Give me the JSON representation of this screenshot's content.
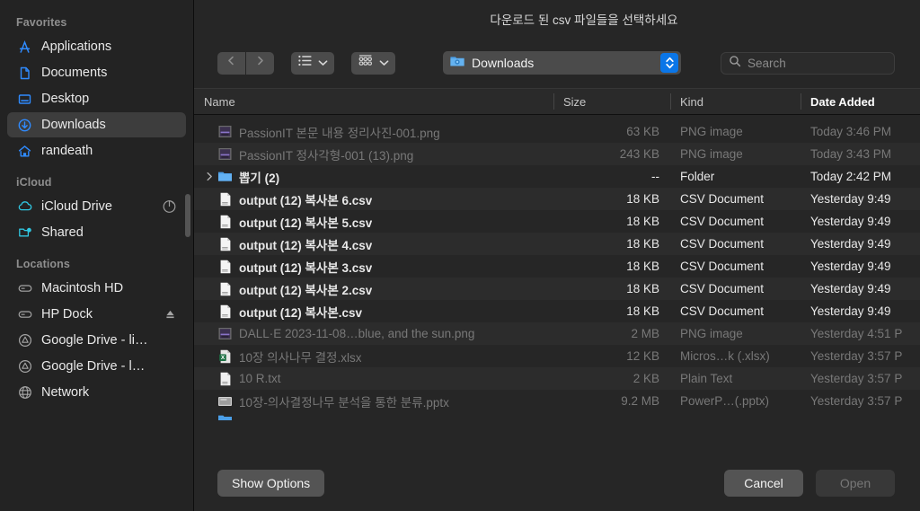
{
  "dialog": {
    "title": "다운로드 된 csv 파일들을 선택하세요"
  },
  "sidebar": {
    "groups": [
      {
        "title": "Favorites",
        "items": [
          {
            "label": "Applications",
            "icon": "applications-icon",
            "selected": false
          },
          {
            "label": "Documents",
            "icon": "document-icon",
            "selected": false
          },
          {
            "label": "Desktop",
            "icon": "desktop-icon",
            "selected": false
          },
          {
            "label": "Downloads",
            "icon": "downloads-icon",
            "selected": true
          },
          {
            "label": "randeath",
            "icon": "home-icon",
            "selected": false
          }
        ]
      },
      {
        "title": "iCloud",
        "items": [
          {
            "label": "iCloud Drive",
            "icon": "cloud-icon",
            "selected": false,
            "trailing": "progress-icon"
          },
          {
            "label": "Shared",
            "icon": "shared-folder-icon",
            "selected": false
          }
        ]
      },
      {
        "title": "Locations",
        "items": [
          {
            "label": "Macintosh HD",
            "icon": "hard-drive-icon",
            "selected": false
          },
          {
            "label": "HP Dock",
            "icon": "hard-drive-icon",
            "selected": false,
            "trailing": "eject-icon"
          },
          {
            "label": "Google Drive - li…",
            "icon": "google-drive-icon",
            "selected": false
          },
          {
            "label": "Google Drive - l…",
            "icon": "google-drive-icon",
            "selected": false
          },
          {
            "label": "Network",
            "icon": "network-icon",
            "selected": false
          }
        ]
      }
    ]
  },
  "toolbar": {
    "back_icon": "chevron-left-icon",
    "forward_icon": "chevron-right-icon",
    "view_icon": "list-view-icon",
    "view_chevron": "chevron-down-icon",
    "group_icon": "group-view-icon",
    "group_chevron": "chevron-down-icon",
    "path": {
      "label": "Downloads",
      "icon": "downloads-folder-icon",
      "stepper_icon": "updown-stepper-icon"
    },
    "search": {
      "placeholder": "Search",
      "icon": "search-icon",
      "value": ""
    }
  },
  "table": {
    "columns": [
      {
        "label": "Name",
        "sorted": false
      },
      {
        "label": "Size",
        "sorted": false
      },
      {
        "label": "Kind",
        "sorted": false
      },
      {
        "label": "Date Added",
        "sorted": true
      }
    ],
    "rows": [
      {
        "name": "PassionIT 본문 내용 정리사진-001.png",
        "size": "63 KB",
        "kind": "PNG image",
        "date": "Today 3:46 PM",
        "icon": "png-thumb-icon",
        "enabled": false,
        "folder": false
      },
      {
        "name": "PassionIT 정사각형-001 (13).png",
        "size": "243 KB",
        "kind": "PNG image",
        "date": "Today 3:43 PM",
        "icon": "png-thumb-icon",
        "enabled": false,
        "folder": false
      },
      {
        "name": "뽑기 (2)",
        "size": "--",
        "kind": "Folder",
        "date": "Today 2:42 PM",
        "icon": "folder-icon",
        "enabled": true,
        "folder": true
      },
      {
        "name": "output (12) 복사본 6.csv",
        "size": "18 KB",
        "kind": "CSV Document",
        "date": "Yesterday 9:49",
        "icon": "csv-file-icon",
        "enabled": true,
        "folder": false
      },
      {
        "name": "output (12) 복사본 5.csv",
        "size": "18 KB",
        "kind": "CSV Document",
        "date": "Yesterday 9:49",
        "icon": "csv-file-icon",
        "enabled": true,
        "folder": false
      },
      {
        "name": "output (12) 복사본 4.csv",
        "size": "18 KB",
        "kind": "CSV Document",
        "date": "Yesterday 9:49",
        "icon": "csv-file-icon",
        "enabled": true,
        "folder": false
      },
      {
        "name": "output (12) 복사본 3.csv",
        "size": "18 KB",
        "kind": "CSV Document",
        "date": "Yesterday 9:49",
        "icon": "csv-file-icon",
        "enabled": true,
        "folder": false
      },
      {
        "name": "output (12) 복사본 2.csv",
        "size": "18 KB",
        "kind": "CSV Document",
        "date": "Yesterday 9:49",
        "icon": "csv-file-icon",
        "enabled": true,
        "folder": false
      },
      {
        "name": "output (12) 복사본.csv",
        "size": "18 KB",
        "kind": "CSV Document",
        "date": "Yesterday 9:49",
        "icon": "csv-file-icon",
        "enabled": true,
        "folder": false
      },
      {
        "name": "DALL·E 2023-11-08…blue, and the sun.png",
        "size": "2 MB",
        "kind": "PNG image",
        "date": "Yesterday 4:51 P",
        "icon": "png-thumb-icon",
        "enabled": false,
        "folder": false
      },
      {
        "name": "10장 의사나무 결정.xlsx",
        "size": "12 KB",
        "kind": "Micros…k (.xlsx)",
        "date": "Yesterday 3:57 P",
        "icon": "xlsx-file-icon",
        "enabled": false,
        "folder": false
      },
      {
        "name": "10 R.txt",
        "size": "2 KB",
        "kind": "Plain Text",
        "date": "Yesterday 3:57 P",
        "icon": "txt-file-icon",
        "enabled": false,
        "folder": false
      },
      {
        "name": "10장-의사결정나무 분석을 통한 분류.pptx",
        "size": "9.2 MB",
        "kind": "PowerP…(.pptx)",
        "date": "Yesterday 3:57 P",
        "icon": "pptx-file-icon",
        "enabled": false,
        "folder": false
      }
    ]
  },
  "footer": {
    "show_options_label": "Show Options",
    "cancel_label": "Cancel",
    "open_label": "Open",
    "open_enabled": false
  },
  "colors": {
    "accent": "#0a76e8",
    "sidebar_icon": "#2f8bff",
    "window_bg": "#262626",
    "sidebar_bg": "#232323"
  }
}
